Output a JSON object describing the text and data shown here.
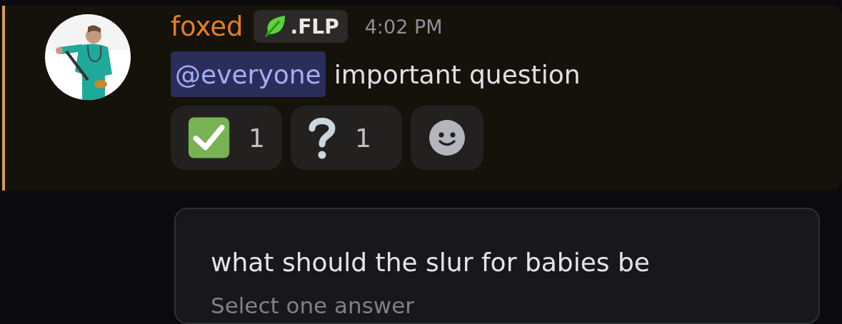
{
  "message": {
    "author": "foxed",
    "tag": ".FLP",
    "time": "4:02 PM",
    "highlighted": true,
    "content": [
      {
        "kind": "mention",
        "text": "@everyone"
      },
      {
        "kind": "text",
        "text": "important question"
      }
    ],
    "reactions": [
      {
        "kind": "check",
        "count": "1",
        "selected": false
      },
      {
        "kind": "question",
        "count": "1",
        "selected": false
      }
    ],
    "add_reaction": true
  },
  "poll": {
    "question": "what should the slur for babies be",
    "hint": "Select one answer"
  }
}
